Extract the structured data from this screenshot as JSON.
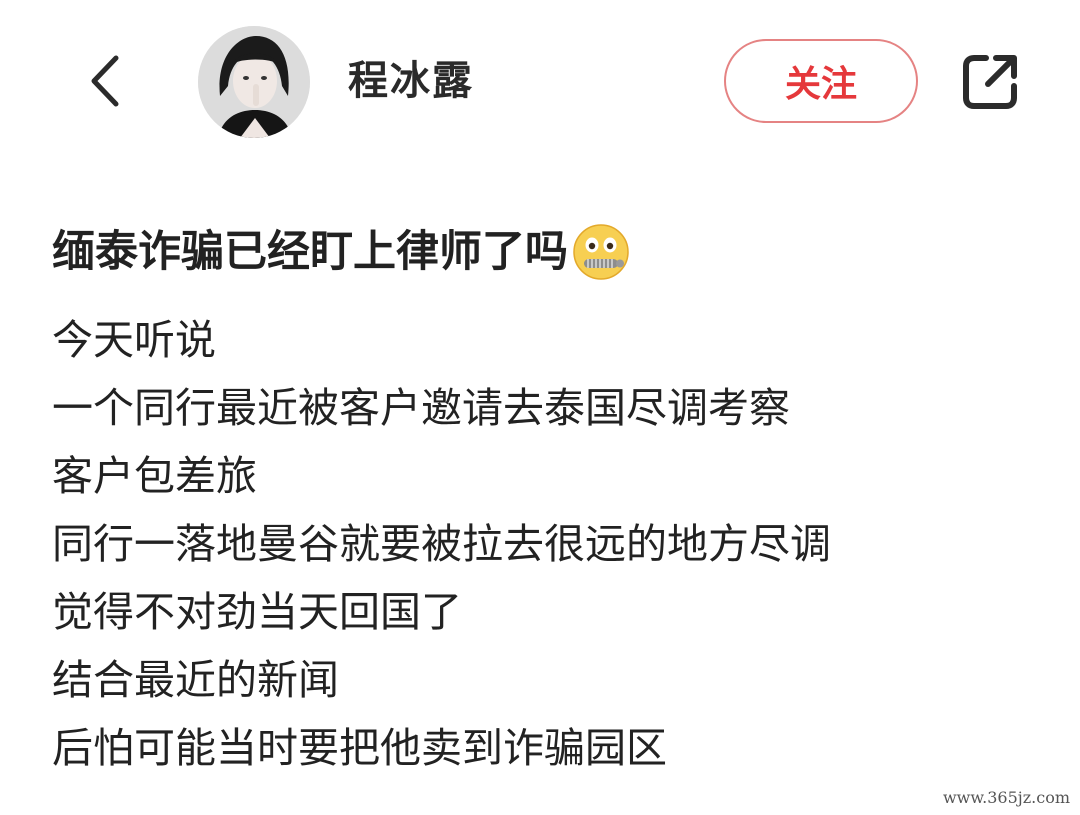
{
  "header": {
    "username": "程冰露",
    "follow_label": "关注",
    "back_icon": "chevron-left-icon",
    "share_icon": "share-external-icon"
  },
  "post": {
    "title": "缅泰诈骗已经盯上律师了吗",
    "title_emoji": "zipper-mouth-face-emoji",
    "lines": [
      "今天听说",
      "一个同行最近被客户邀请去泰国尽调考察",
      "客户包差旅",
      "同行一落地曼谷就要被拉去很远的地方尽调",
      "觉得不对劲当天回国了",
      "结合最近的新闻",
      "后怕可能当时要把他卖到诈骗园区"
    ]
  },
  "watermark": "www.365jz.com",
  "colors": {
    "follow_text": "#e5383b",
    "follow_border": "#e58383",
    "text": "#222222"
  }
}
